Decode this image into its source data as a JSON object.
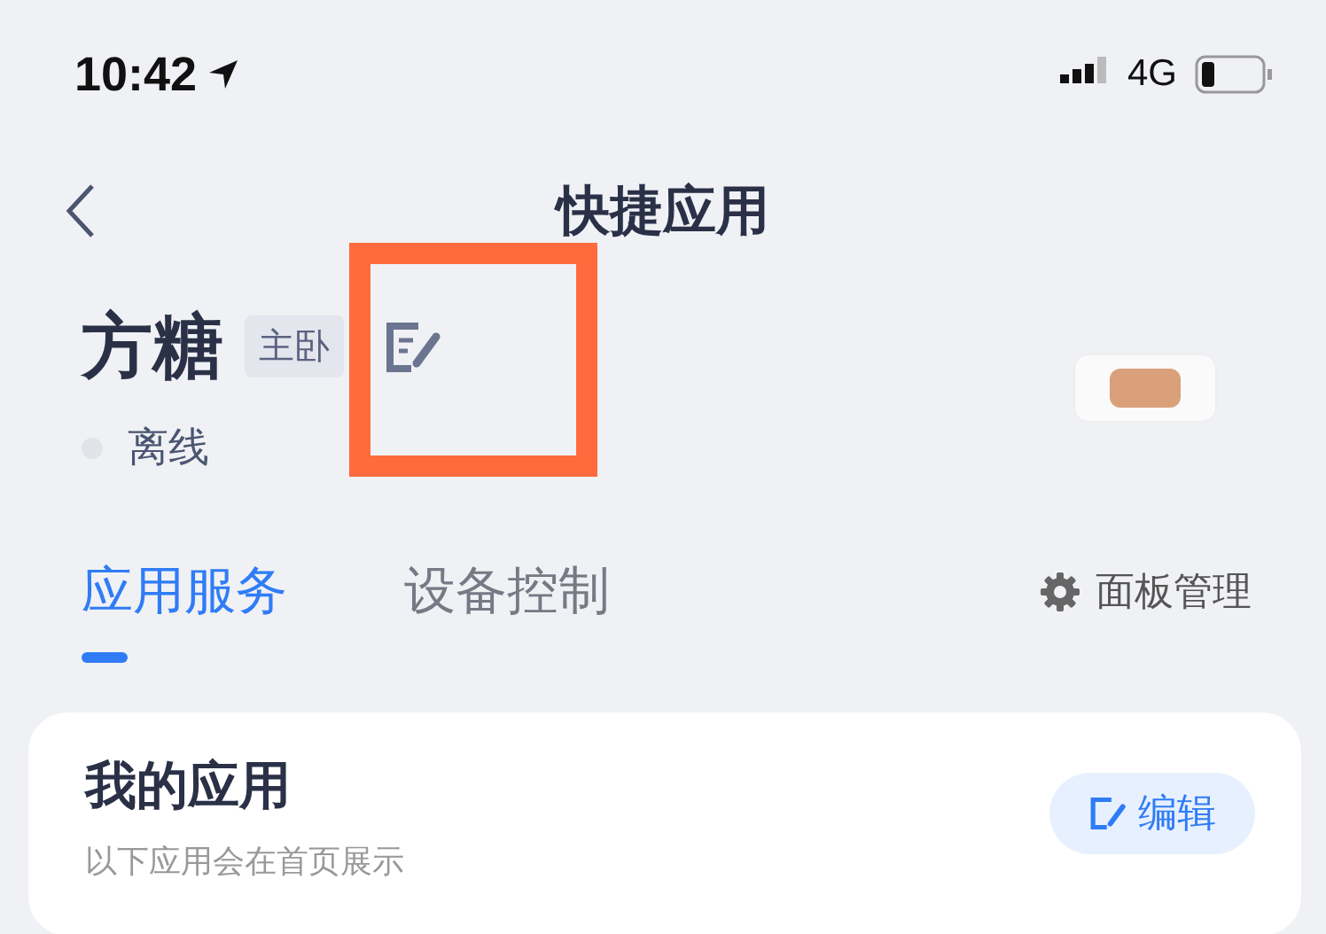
{
  "status_bar": {
    "time": "10:42",
    "network": "4G"
  },
  "nav": {
    "title": "快捷应用"
  },
  "device": {
    "name": "方糖",
    "room": "主卧",
    "status": "离线",
    "online": false
  },
  "highlight": {
    "color": "#ff6b3d"
  },
  "tabs": [
    {
      "label": "应用服务",
      "selected": true
    },
    {
      "label": "设备控制",
      "selected": false
    }
  ],
  "panel_button": {
    "label": "面板管理"
  },
  "card": {
    "title": "我的应用",
    "subtitle": "以下应用会在首页展示",
    "edit_button": "编辑"
  }
}
